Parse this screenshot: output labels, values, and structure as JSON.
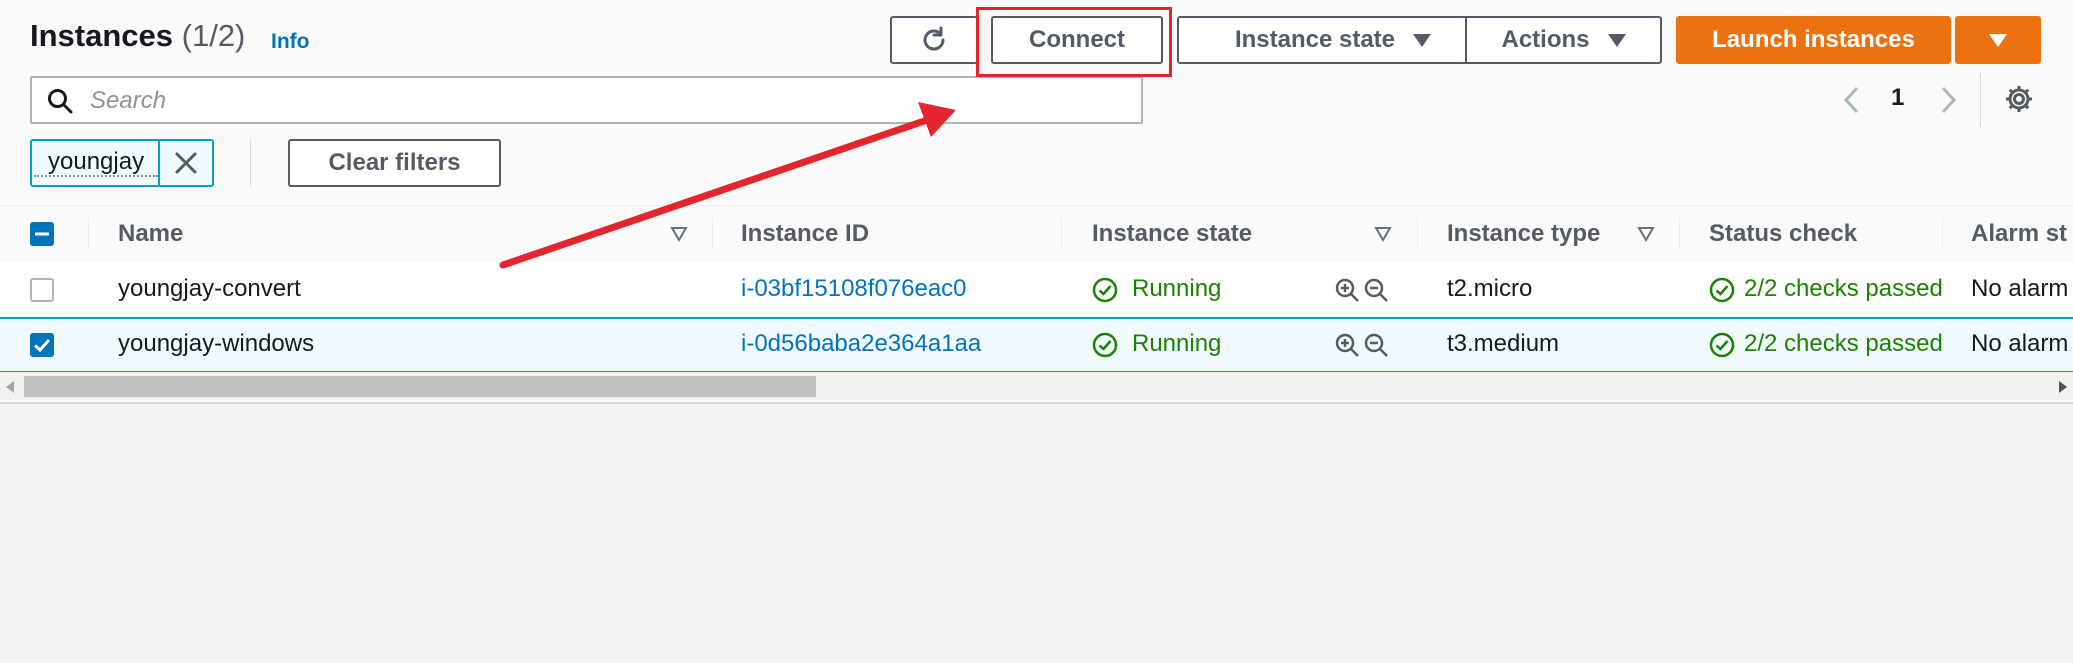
{
  "header": {
    "title": "Instances",
    "count": "(1/2)",
    "info_link": "Info"
  },
  "toolbar": {
    "refresh_icon": "refresh-icon",
    "connect_label": "Connect",
    "instance_state_label": "Instance state",
    "actions_label": "Actions",
    "launch_label": "Launch instances"
  },
  "search": {
    "placeholder": "Search",
    "value": ""
  },
  "pagination": {
    "current_page": "1"
  },
  "filters": {
    "token": "youngjay",
    "clear_label": "Clear filters"
  },
  "table": {
    "columns": [
      "Name",
      "Instance ID",
      "Instance state",
      "Instance type",
      "Status check",
      "Alarm st"
    ],
    "rows": [
      {
        "selected": false,
        "name": "youngjay-convert",
        "instance_id": "i-03bf15108f076eac0",
        "state": "Running",
        "type": "t2.micro",
        "status_check": "2/2 checks passed",
        "alarm": "No alarm"
      },
      {
        "selected": true,
        "name": "youngjay-windows",
        "instance_id": "i-0d56baba2e364a1aa",
        "state": "Running",
        "type": "t3.medium",
        "status_check": "2/2 checks passed",
        "alarm": "No alarm"
      }
    ]
  },
  "colors": {
    "primary": "#ec7211",
    "link": "#0073bb",
    "success": "#1d8102",
    "annotation": "#e3262e"
  }
}
